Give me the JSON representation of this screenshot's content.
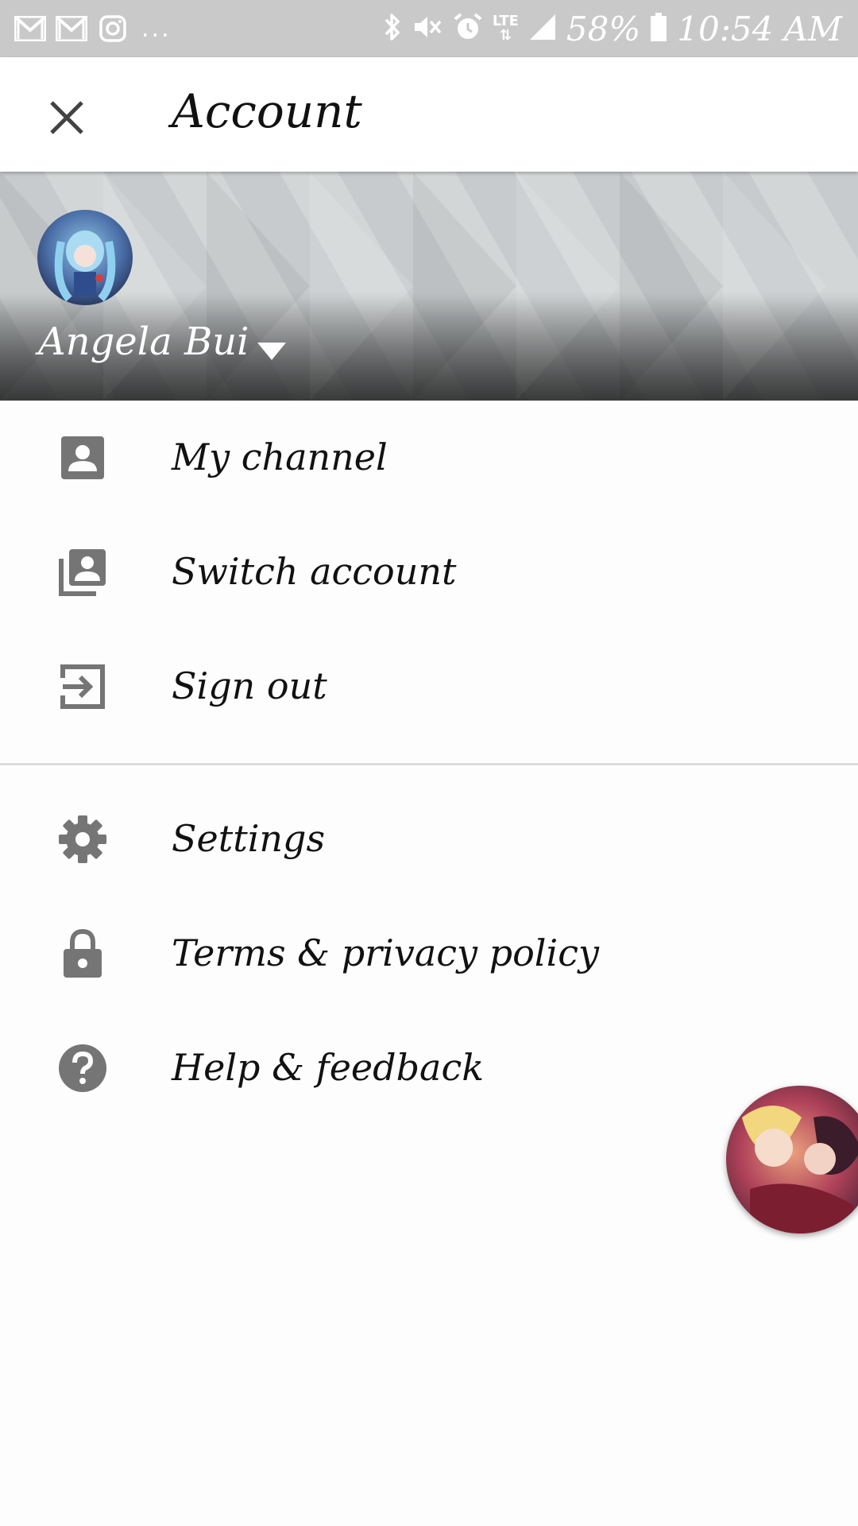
{
  "status_bar": {
    "left_icons": [
      "gmail-icon",
      "gmail-icon",
      "instagram-icon"
    ],
    "overflow": "...",
    "right_icons": [
      "bluetooth-icon",
      "vibrate-mute-icon",
      "alarm-icon"
    ],
    "network": "LTE",
    "battery": "58%",
    "time": "10:54 AM"
  },
  "appbar": {
    "title": "Account",
    "close_icon": "close-icon"
  },
  "account": {
    "name": "Angela Bui"
  },
  "menu": {
    "primary": [
      {
        "label": "My channel",
        "icon": "person-box-icon"
      },
      {
        "label": "Switch account",
        "icon": "switch-account-icon"
      },
      {
        "label": "Sign out",
        "icon": "exit-icon"
      }
    ],
    "secondary": [
      {
        "label": "Settings",
        "icon": "gear-icon"
      },
      {
        "label": "Terms & privacy policy",
        "icon": "lock-icon"
      },
      {
        "label": "Help & feedback",
        "icon": "help-icon"
      }
    ]
  },
  "colors": {
    "status_bar": "#c9c9c9",
    "icon_gray": "#757575",
    "text": "#111111"
  }
}
